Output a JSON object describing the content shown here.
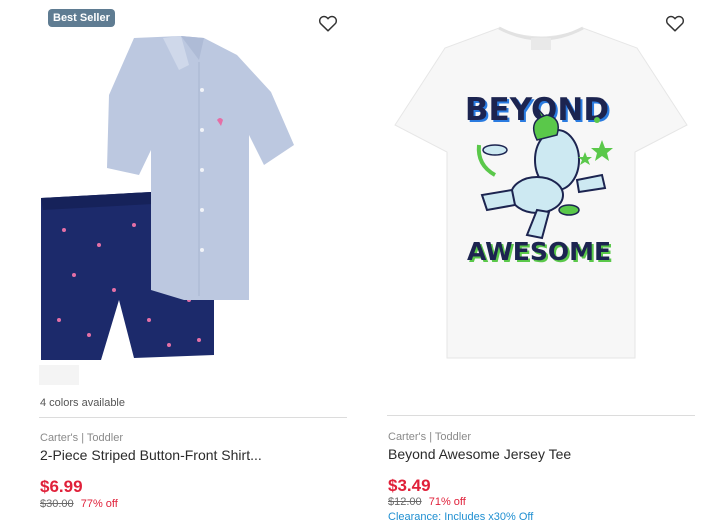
{
  "products": [
    {
      "badge": "Best Seller",
      "colors_available": "4 colors available",
      "brand": "Carter's | Toddler",
      "title": "2-Piece Striped Button-Front Shirt...",
      "price": "$6.99",
      "original_price": "$30.00",
      "discount": "77% off"
    },
    {
      "brand": "Carter's | Toddler",
      "title": "Beyond Awesome Jersey Tee",
      "price": "$3.49",
      "original_price": "$12.00",
      "discount": "71% off",
      "promo": "Clearance: Includes x30% Off",
      "print_text": [
        "BEYOND",
        "AWESOME"
      ]
    }
  ],
  "icons": {
    "wishlist": "heart-outline-icon"
  },
  "colors": {
    "sale_red": "#e0213a",
    "badge_bg": "#5f7c92",
    "clearance_blue": "#1f8fd1"
  }
}
